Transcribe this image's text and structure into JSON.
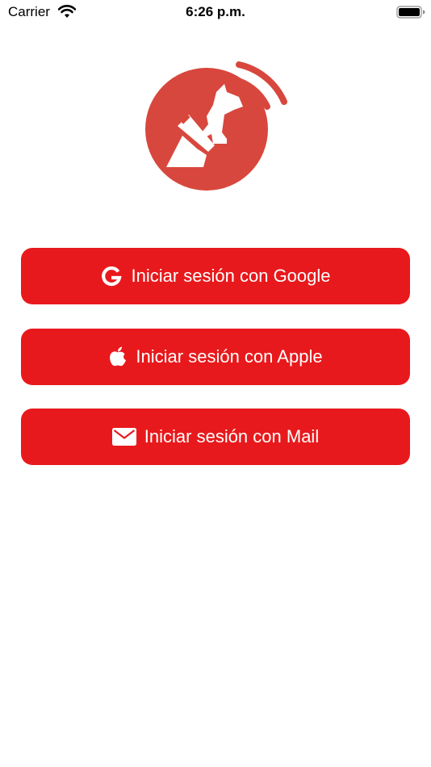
{
  "status_bar": {
    "carrier": "Carrier",
    "time": "6:26 p.m."
  },
  "icons": {
    "wifi": "wifi-icon",
    "battery": "battery-icon",
    "logo": "guide-dog-signal-logo",
    "google": "google-g-icon",
    "apple": "apple-icon",
    "mail": "envelope-icon"
  },
  "login": {
    "google_label": "Iniciar sesión con Google",
    "apple_label": "Iniciar sesión con Apple",
    "mail_label": "Iniciar sesión con Mail"
  },
  "colors": {
    "button_background": "#e8191c",
    "logo_background": "#d8473d",
    "button_text": "#ffffff"
  }
}
